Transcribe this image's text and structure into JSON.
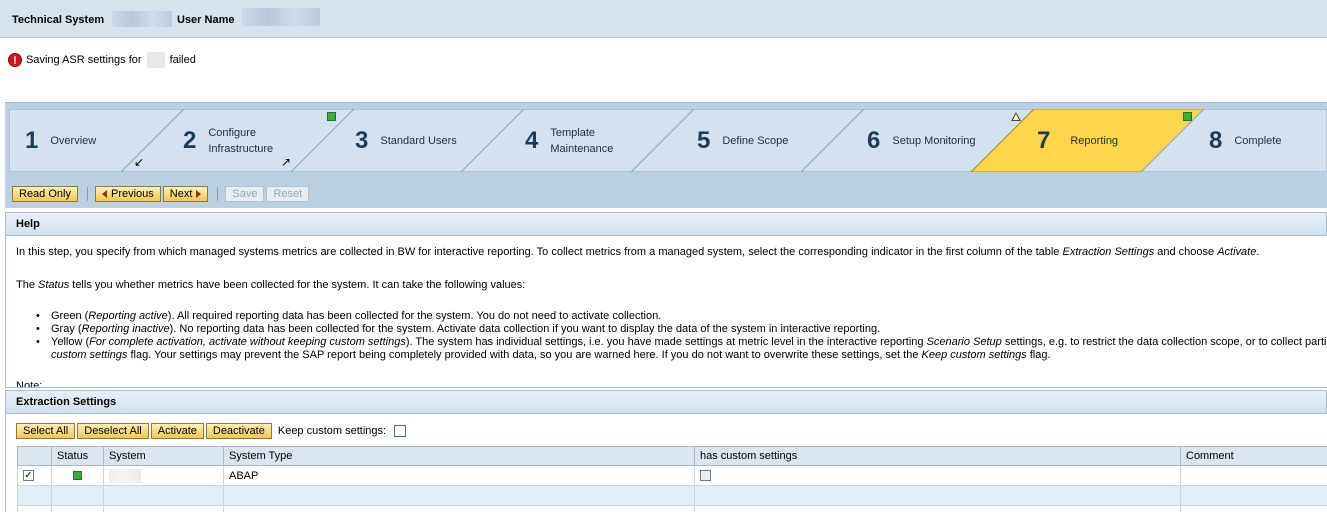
{
  "header": {
    "technical_system_label": "Technical System",
    "user_name_label": "User Name"
  },
  "message": {
    "prefix": "Saving ASR settings for",
    "suffix": "failed",
    "icon": "error-icon",
    "color": "#d0171b"
  },
  "roadmap": {
    "steps": [
      {
        "num": "1",
        "line1": "Overview",
        "line2": ""
      },
      {
        "num": "2",
        "line1": "Configure",
        "line2": "Infrastructure",
        "status": "green"
      },
      {
        "num": "3",
        "line1": "Standard Users",
        "line2": ""
      },
      {
        "num": "4",
        "line1": "Template",
        "line2": "Maintenance"
      },
      {
        "num": "5",
        "line1": "Define Scope",
        "line2": ""
      },
      {
        "num": "6",
        "line1": "Setup Monitoring",
        "line2": "",
        "status": "warning"
      },
      {
        "num": "7",
        "line1": "Reporting",
        "line2": "",
        "active": true,
        "status": "green"
      },
      {
        "num": "8",
        "line1": "Complete",
        "line2": ""
      }
    ],
    "active_color": "#ffd54a",
    "inactive_color": "#d4e2f0"
  },
  "toolbar": {
    "read_only": "Read Only",
    "previous": "Previous",
    "next": "Next",
    "save": "Save",
    "reset": "Reset"
  },
  "help": {
    "title": "Help",
    "p1_a": "In this step, you specify from which managed systems metrics are collected in BW for interactive reporting. To collect metrics from a managed system, select the corresponding indicator in the first column of the table ",
    "p1_b": "Extraction Settings",
    "p1_c": " and choose ",
    "p1_d": "Activate",
    "p1_e": ".",
    "p2_a": "The ",
    "p2_b": "Status",
    "p2_c": " tells you whether metrics have been collected for the system. It can take the following values:",
    "b1_a": "Green (",
    "b1_b": "Reporting active",
    "b1_c": "). All required reporting data has been collected for the system. You do not need to activate collection.",
    "b2_a": "Gray (",
    "b2_b": "Reporting inactive",
    "b2_c": "). No reporting data has been collected for the system. Activate data collection if you want to display the data of the system in interactive reporting.",
    "b3_a": "Yellow (",
    "b3_b": "For complete activation, activate without keeping custom settings",
    "b3_c": "). The system has individual settings, i.e. you have made settings at metric level in the interactive reporting ",
    "b3_d": "Scenario Setup",
    "b3_e": " settings, e.g. to restrict the data collection scope, or to collect parti",
    "b3_f": "custom settings",
    "b3_g": " flag. Your settings may prevent the SAP report being completely provided with data, so you are warned here. If you do not want to overwrite these settings, set the ",
    "b3_h": "Keep custom settings",
    "b3_i": " flag.",
    "note": "Note:"
  },
  "extraction": {
    "title": "Extraction Settings",
    "select_all": "Select All",
    "deselect_all": "Deselect All",
    "activate": "Activate",
    "deactivate": "Deactivate",
    "keep_custom": "Keep custom settings:",
    "columns": [
      "Status",
      "System",
      "System Type",
      "has custom settings",
      "Comment"
    ],
    "rows": [
      {
        "checked": true,
        "status": "green",
        "system": "",
        "system_type": "ABAP",
        "has_custom": false,
        "comment": ""
      }
    ]
  }
}
